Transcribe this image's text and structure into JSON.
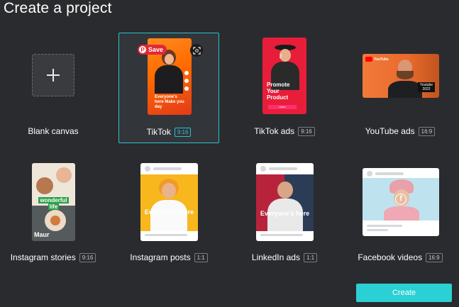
{
  "header": {
    "title": "Create a project"
  },
  "templates": [
    {
      "label": "Blank canvas",
      "ratio": ""
    },
    {
      "label": "TikTok",
      "ratio": "9:16",
      "badge": "Save",
      "overlay": "Everyone's here Make you day"
    },
    {
      "label": "TikTok ads",
      "ratio": "9:16",
      "overlay": "Promote Your Product",
      "cta": "more"
    },
    {
      "label": "YouTube ads",
      "ratio": "16:9",
      "logo": "YouTube",
      "tag": "Youtube 2022"
    },
    {
      "label": "Instagram stories",
      "ratio": "9:16",
      "overlay_top": "wonderful",
      "overlay_bottom": "life",
      "brand": "Maur"
    },
    {
      "label": "Instagram posts",
      "ratio": "1:1",
      "overlay": "Everyone's here"
    },
    {
      "label": "LinkedIn ads",
      "ratio": "1:1",
      "overlay": "Everyone's here"
    },
    {
      "label": "Facebook videos",
      "ratio": "16:9"
    }
  ],
  "footer": {
    "create_label": "Create"
  },
  "colors": {
    "background": "#2a2b2e",
    "accent": "#2bc3c9",
    "create_button": "#2bd0d4",
    "pinterest": "#e02935"
  }
}
